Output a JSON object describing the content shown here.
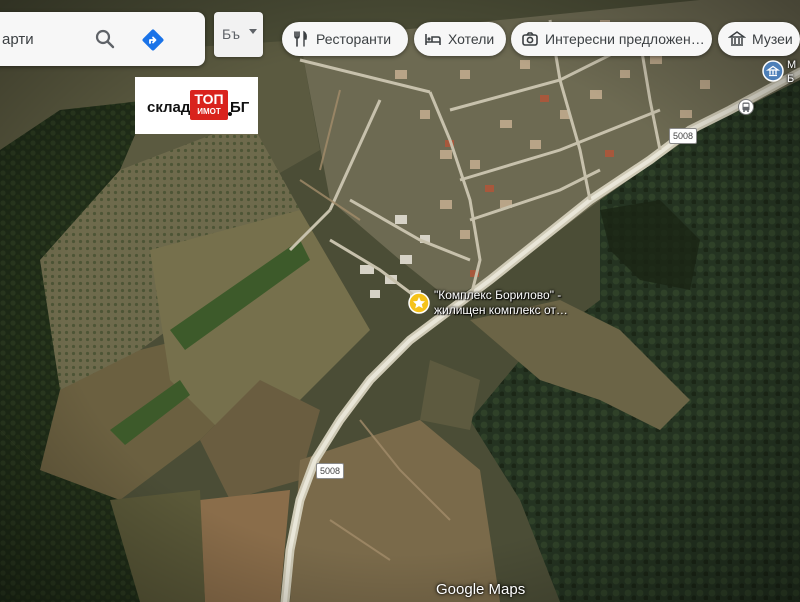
{
  "search": {
    "placeholder": "арти"
  },
  "language": {
    "label": "Бъ"
  },
  "chips": [
    {
      "label": "Ресторанти",
      "icon": "fork-knife-icon"
    },
    {
      "label": "Хотели",
      "icon": "bed-icon"
    },
    {
      "label": "Интересни предложен…",
      "icon": "camera-icon"
    },
    {
      "label": "Музеи",
      "icon": "museum-icon"
    }
  ],
  "logo": {
    "left_word": "склад",
    "red_top": "ТОП",
    "red_bottom": "ИМОТ",
    "right_word": "БГ"
  },
  "roads": {
    "top_badge": "5008",
    "bottom_badge": "5008"
  },
  "place": {
    "line1": "\"Комплекс Борилово\" -",
    "line2": "жилищен комплекс от…"
  },
  "museum_partial": {
    "line1": "М",
    "line2": "Б"
  },
  "attribution": "Google Maps",
  "colors": {
    "marker_yellow": "#f5c21a",
    "museum_blue": "#4d7fb8",
    "chip_bg": "#f7f7f7",
    "chip_text": "#3c4043"
  }
}
